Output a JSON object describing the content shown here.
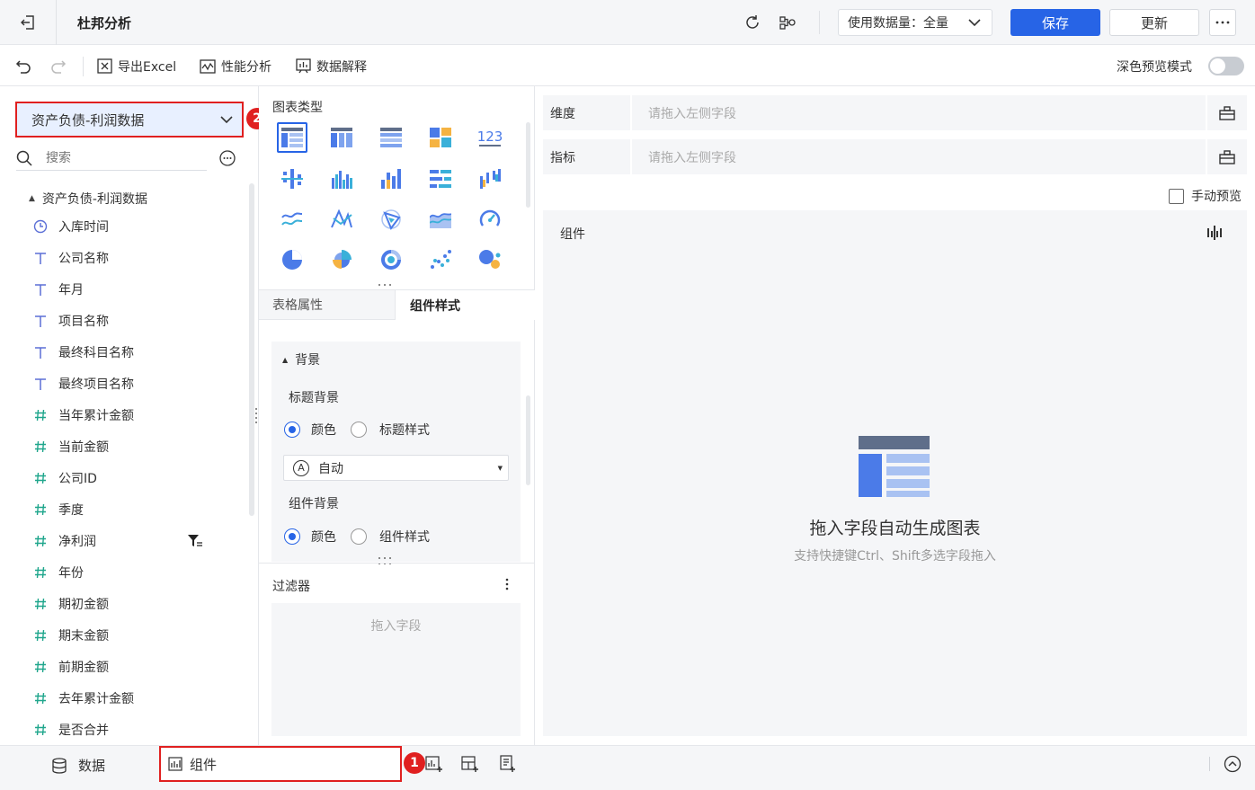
{
  "topbar": {
    "title": "杜邦分析",
    "data_usage": "使用数据量：全量",
    "save": "保存",
    "update": "更新"
  },
  "toolbar": {
    "export_excel": "导出Excel",
    "perf_analysis": "性能分析",
    "data_explain": "数据解释",
    "dark_preview": "深色预览模式"
  },
  "left": {
    "dataset": "资产负债-利润数据",
    "search_placeholder": "搜索",
    "tree_root": "资产负债-利润数据",
    "fields": [
      {
        "type": "time",
        "name": "入库时间"
      },
      {
        "type": "text",
        "name": "公司名称"
      },
      {
        "type": "text",
        "name": "年月"
      },
      {
        "type": "text",
        "name": "项目名称"
      },
      {
        "type": "text",
        "name": "最终科目名称"
      },
      {
        "type": "text",
        "name": "最终项目名称"
      },
      {
        "type": "number",
        "name": "当年累计金额"
      },
      {
        "type": "number",
        "name": "当前金额"
      },
      {
        "type": "number",
        "name": "公司ID"
      },
      {
        "type": "number",
        "name": "季度"
      },
      {
        "type": "number",
        "name": "净利润"
      },
      {
        "type": "number",
        "name": "年份"
      },
      {
        "type": "number",
        "name": "期初金额"
      },
      {
        "type": "number",
        "name": "期末金额"
      },
      {
        "type": "number",
        "name": "前期金额"
      },
      {
        "type": "number",
        "name": "去年累计金额"
      },
      {
        "type": "number",
        "name": "是否合并"
      }
    ]
  },
  "middle": {
    "chart_type_title": "图表类型",
    "kpi_icon_text": "123",
    "tabs": [
      "表格属性",
      "组件样式"
    ],
    "background_section": "背景",
    "title_bg": "标题背景",
    "color": "颜色",
    "title_style": "标题样式",
    "auto": "自动",
    "auto_icon": "A",
    "component_bg": "组件背景",
    "component_style": "组件样式",
    "filter_title": "过滤器",
    "drag_field": "拖入字段"
  },
  "right": {
    "dimension": "维度",
    "measure": "指标",
    "drop_placeholder": "请拖入左侧字段",
    "manual_preview": "手动预览",
    "component_label": "组件",
    "empty_title": "拖入字段自动生成图表",
    "empty_hint": "支持快捷键Ctrl、Shift多选字段拖入"
  },
  "bottom": {
    "data_tab": "数据",
    "component_tab": "组件"
  },
  "badges": [
    "2",
    "1"
  ],
  "colors": {
    "primary": "#2764e6",
    "highlight_border": "#e02020",
    "icon_blue": "#5b6fd6"
  }
}
